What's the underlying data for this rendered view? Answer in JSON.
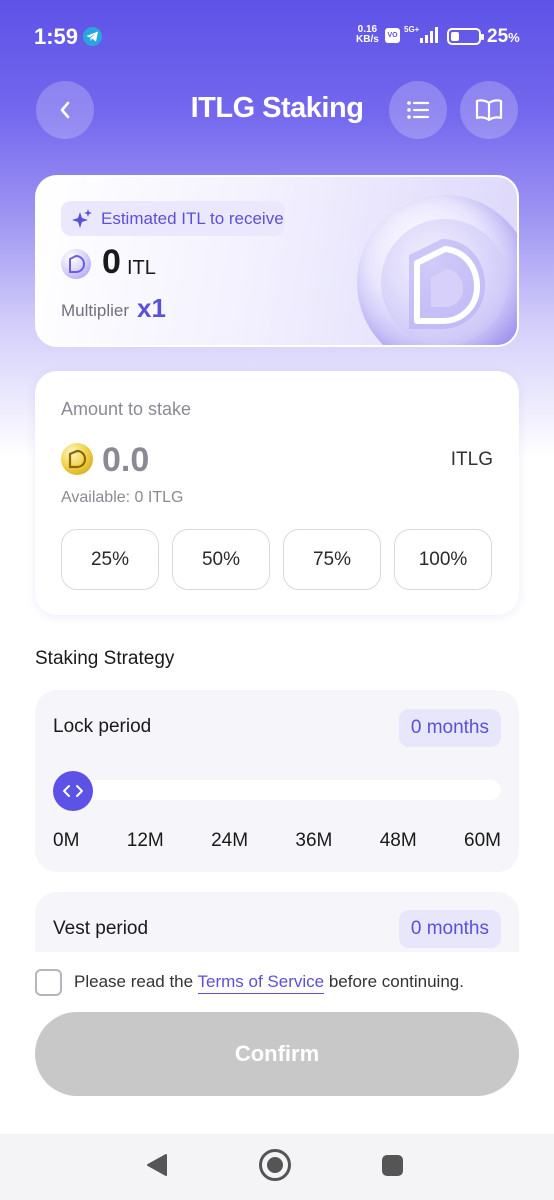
{
  "status_bar": {
    "time": "1:59",
    "net_speed_value": "0.16",
    "net_speed_unit": "KB/s",
    "network": "5G+",
    "battery_percent": "25",
    "battery_unit": "%"
  },
  "header": {
    "title": "ITLG Staking",
    "back_icon": "chevron-left-icon",
    "list_icon": "list-icon",
    "guide_icon": "book-icon"
  },
  "estimate": {
    "pill_label": "Estimated ITL to receive",
    "value": "0",
    "unit": "ITL",
    "multiplier_label": "Multiplier",
    "multiplier_value": "x1"
  },
  "stake": {
    "label": "Amount to stake",
    "amount": "0.0",
    "unit": "ITLG",
    "available": "Available: 0 ITLG",
    "percent_buttons": [
      "25%",
      "50%",
      "75%",
      "100%"
    ]
  },
  "strategy": {
    "title": "Staking Strategy",
    "lock": {
      "label": "Lock period",
      "value": "0 months",
      "slider_fraction": 0,
      "ticks": [
        "0M",
        "12M",
        "24M",
        "36M",
        "48M",
        "60M"
      ]
    },
    "vest": {
      "label": "Vest period",
      "value": "0 months"
    }
  },
  "terms": {
    "checked": false,
    "before": "Please read the ",
    "link": "Terms of Service",
    "after": " before continuing."
  },
  "confirm_label": "Confirm",
  "colors": {
    "accent": "#5d52e6",
    "accent_text": "#5b50d8",
    "disabled_button": "#c8c8c8"
  }
}
